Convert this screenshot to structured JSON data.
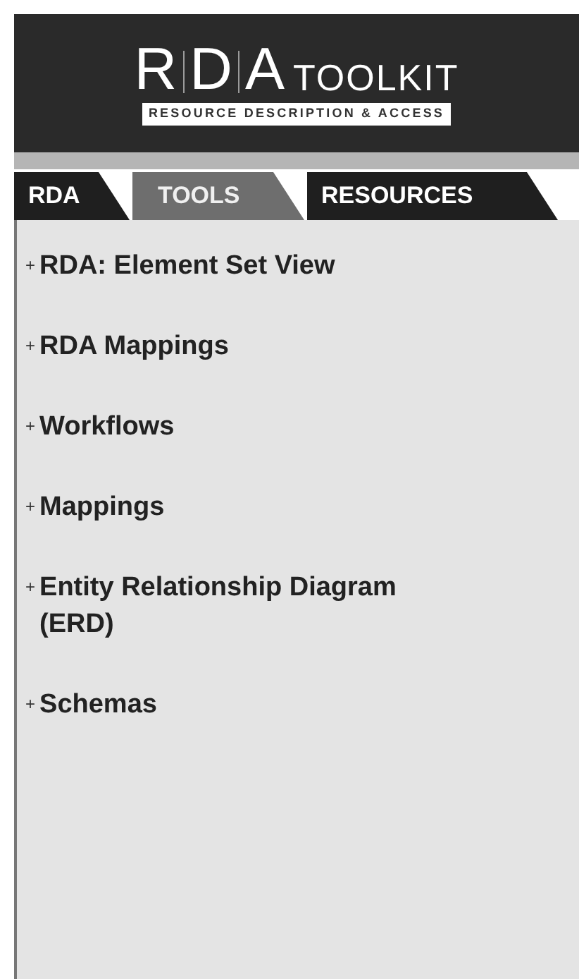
{
  "logo": {
    "letters": [
      "R",
      "D",
      "A"
    ],
    "word": "TOOLKIT",
    "tagline": "RESOURCE DESCRIPTION & ACCESS"
  },
  "tabs": [
    {
      "label": "RDA",
      "selected": false
    },
    {
      "label": "TOOLS",
      "selected": true
    },
    {
      "label": "RESOURCES",
      "selected": false
    }
  ],
  "menu": [
    {
      "marker": "+",
      "label": "RDA: Element Set View"
    },
    {
      "marker": "+",
      "label": "RDA Mappings"
    },
    {
      "marker": "+",
      "label": "Workflows"
    },
    {
      "marker": "+",
      "label": "Mappings"
    },
    {
      "marker": "+",
      "label": "Entity Relationship Diagram (ERD)"
    },
    {
      "marker": "+",
      "label": "Schemas"
    }
  ]
}
